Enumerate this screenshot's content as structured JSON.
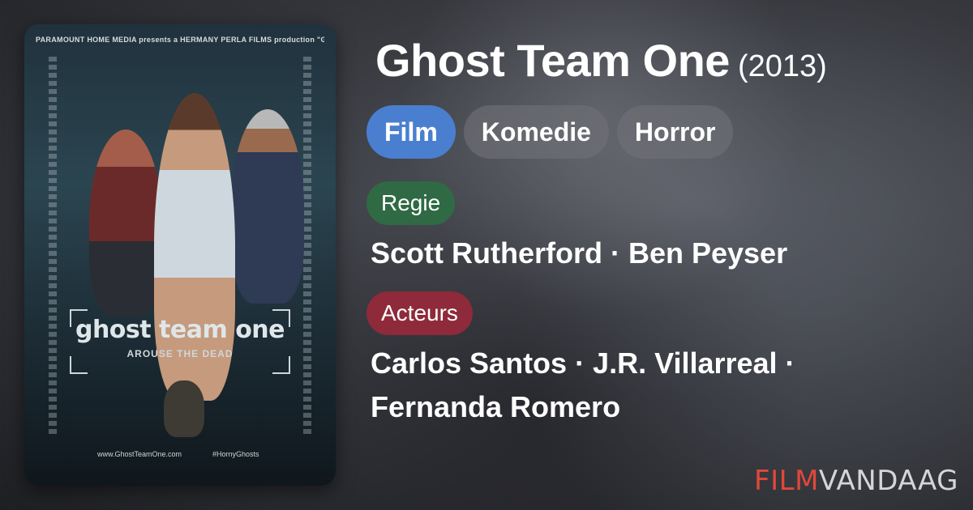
{
  "movie": {
    "title": "Ghost Team One",
    "year": "(2013)"
  },
  "genres": [
    "Film",
    "Komedie",
    "Horror"
  ],
  "regie": {
    "label": "Regie",
    "names": "Scott Rutherford · Ben Peyser"
  },
  "acteurs": {
    "label": "Acteurs",
    "line1": "Carlos Santos · J.R. Villarreal ·",
    "line2": "Fernanda Romero"
  },
  "poster": {
    "credits_top": "PARAMOUNT HOME MEDIA presents a HERMANY PERLA FILMS production \"GHOST TEAM ONE\" CARLOS SANTOS J.R. VILLARREAL",
    "title": "ghost team one",
    "tagline": "AROUSE THE DEAD",
    "website": "www.GhostTeamOne.com",
    "hashtag": "#HornyGhosts"
  },
  "brand": {
    "part1": "FILM",
    "part2": "VANDAAG"
  },
  "colors": {
    "film_pill": "#4a7fd0",
    "regie_label": "#2f6a44",
    "acteurs_label": "#8e2a3a",
    "brand_red": "#e0483a"
  }
}
